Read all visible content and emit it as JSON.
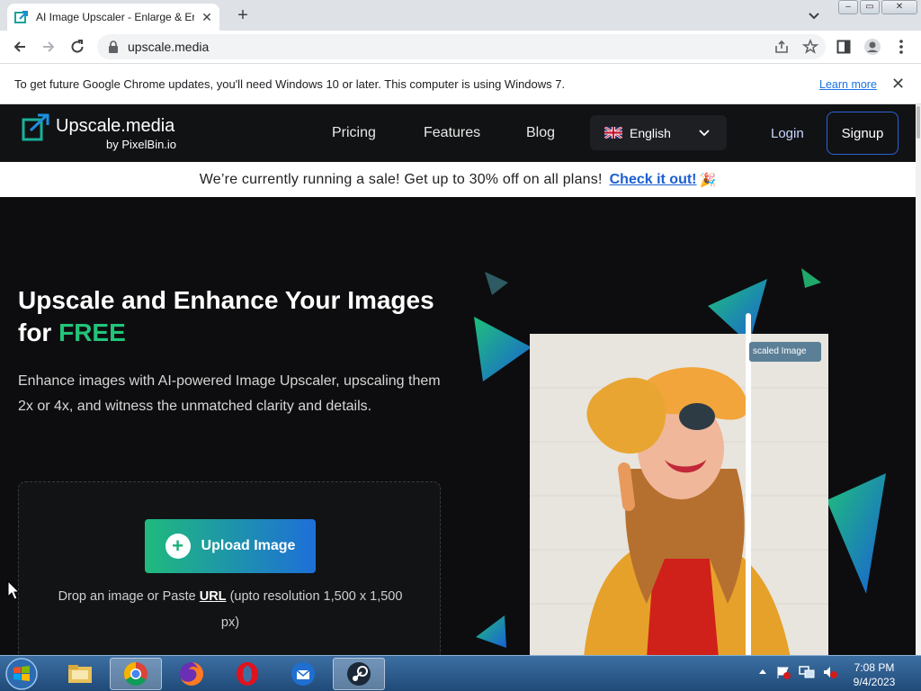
{
  "browser": {
    "tab_title": "AI Image Upscaler - Enlarge & Er",
    "url": "upscale.media",
    "infobar_text": "To get future Google Chrome updates, you'll need Windows 10 or later. This computer is using Windows 7.",
    "infobar_link": "Learn more"
  },
  "site": {
    "brand": "Upscale.media",
    "brand_sub": "by PixelBin.io",
    "nav": [
      "Pricing",
      "Features",
      "Blog"
    ],
    "language": "English",
    "login": "Login",
    "signup": "Signup",
    "sale_text": "We’re currently running a sale! Get up to 30% off on all plans!",
    "sale_link": "Check it out!",
    "sale_emoji": "🎉"
  },
  "hero": {
    "title_line1": "Upscale and Enhance Your Images",
    "title_for": "for",
    "title_free": "FREE",
    "description": "Enhance images with AI-powered Image Upscaler, upscaling them 2x or 4x, and witness the unmatched clarity and details.",
    "upload_label": "Upload Image",
    "drop_text_before": "Drop an image or Paste",
    "drop_url": "URL",
    "drop_text_after": "(upto resolution 1,500 x 1,500 px)",
    "badge": "scaled Image"
  },
  "taskbar": {
    "time": "7:08 PM",
    "date": "9/4/2023"
  },
  "colors": {
    "accent_green": "#22c47a",
    "accent_blue": "#1e6fd8",
    "link_blue": "#1b5fd1"
  }
}
